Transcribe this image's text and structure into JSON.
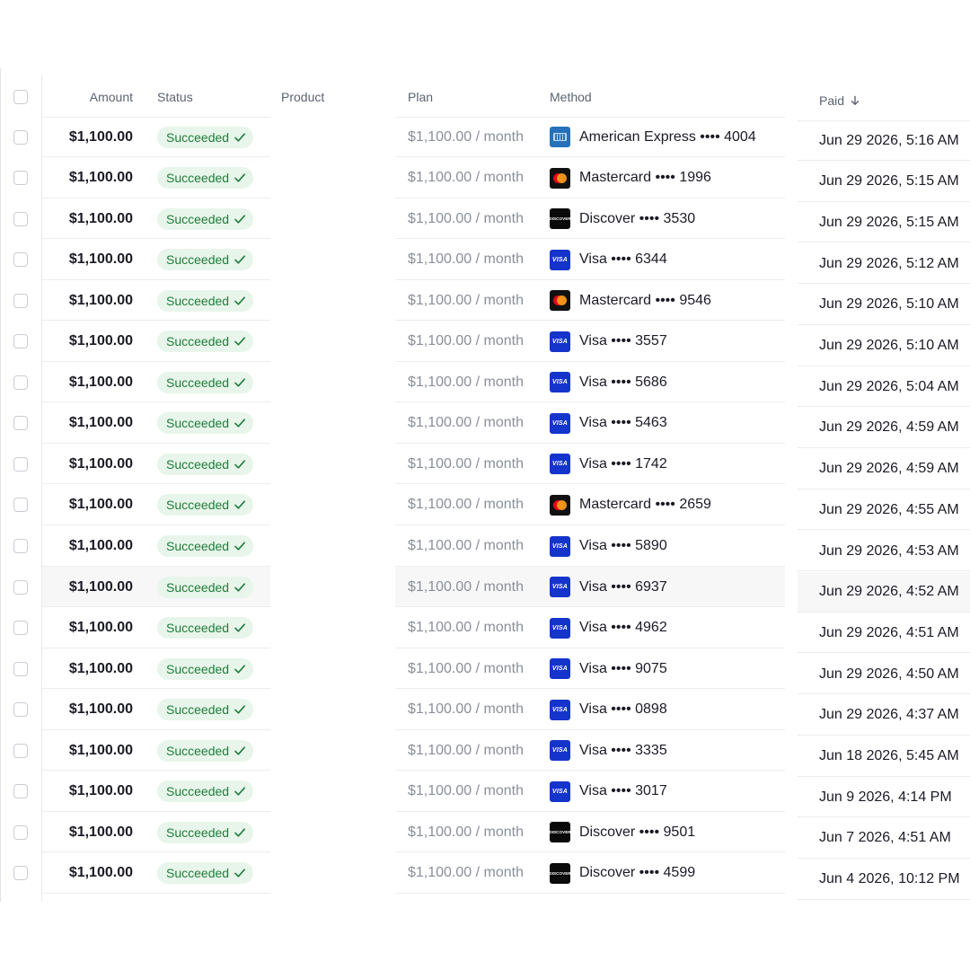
{
  "columns": {
    "amount": "Amount",
    "status": "Status",
    "product": "Product",
    "plan": "Plan",
    "method": "Method",
    "paid": "Paid"
  },
  "sort_indicator_icon": "arrow-down-icon",
  "rows": [
    {
      "amount": "$1,100.00",
      "status": "Succeeded",
      "product": "",
      "plan": "$1,100.00 / month",
      "card": "amex",
      "method": "American Express •••• 4004",
      "paid": "Jun 29 2026, 5:16 AM"
    },
    {
      "amount": "$1,100.00",
      "status": "Succeeded",
      "product": "",
      "plan": "$1,100.00 / month",
      "card": "mastercard",
      "method": "Mastercard •••• 1996",
      "paid": "Jun 29 2026, 5:15 AM"
    },
    {
      "amount": "$1,100.00",
      "status": "Succeeded",
      "product": "",
      "plan": "$1,100.00 / month",
      "card": "discover",
      "method": "Discover •••• 3530",
      "paid": "Jun 29 2026, 5:15 AM"
    },
    {
      "amount": "$1,100.00",
      "status": "Succeeded",
      "product": "",
      "plan": "$1,100.00 / month",
      "card": "visa",
      "method": "Visa •••• 6344",
      "paid": "Jun 29 2026, 5:12 AM"
    },
    {
      "amount": "$1,100.00",
      "status": "Succeeded",
      "product": "",
      "plan": "$1,100.00 / month",
      "card": "mastercard",
      "method": "Mastercard •••• 9546",
      "paid": "Jun 29 2026, 5:10 AM"
    },
    {
      "amount": "$1,100.00",
      "status": "Succeeded",
      "product": "",
      "plan": "$1,100.00 / month",
      "card": "visa",
      "method": "Visa •••• 3557",
      "paid": "Jun 29 2026, 5:10 AM"
    },
    {
      "amount": "$1,100.00",
      "status": "Succeeded",
      "product": "",
      "plan": "$1,100.00 / month",
      "card": "visa",
      "method": "Visa •••• 5686",
      "paid": "Jun 29 2026, 5:04 AM"
    },
    {
      "amount": "$1,100.00",
      "status": "Succeeded",
      "product": "",
      "plan": "$1,100.00 / month",
      "card": "visa",
      "method": "Visa •••• 5463",
      "paid": "Jun 29 2026, 4:59 AM"
    },
    {
      "amount": "$1,100.00",
      "status": "Succeeded",
      "product": "",
      "plan": "$1,100.00 / month",
      "card": "visa",
      "method": "Visa •••• 1742",
      "paid": "Jun 29 2026, 4:59 AM"
    },
    {
      "amount": "$1,100.00",
      "status": "Succeeded",
      "product": "",
      "plan": "$1,100.00 / month",
      "card": "mastercard",
      "method": "Mastercard •••• 2659",
      "paid": "Jun 29 2026, 4:55 AM"
    },
    {
      "amount": "$1,100.00",
      "status": "Succeeded",
      "product": "",
      "plan": "$1,100.00 / month",
      "card": "visa",
      "method": "Visa •••• 5890",
      "paid": "Jun 29 2026, 4:53 AM"
    },
    {
      "amount": "$1,100.00",
      "status": "Succeeded",
      "product": "",
      "plan": "$1,100.00 / month",
      "card": "visa",
      "method": "Visa •••• 6937",
      "paid": "Jun 29 2026, 4:52 AM",
      "hover": true
    },
    {
      "amount": "$1,100.00",
      "status": "Succeeded",
      "product": "",
      "plan": "$1,100.00 / month",
      "card": "visa",
      "method": "Visa •••• 4962",
      "paid": "Jun 29 2026, 4:51 AM"
    },
    {
      "amount": "$1,100.00",
      "status": "Succeeded",
      "product": "",
      "plan": "$1,100.00 / month",
      "card": "visa",
      "method": "Visa •••• 9075",
      "paid": "Jun 29 2026, 4:50 AM"
    },
    {
      "amount": "$1,100.00",
      "status": "Succeeded",
      "product": "",
      "plan": "$1,100.00 / month",
      "card": "visa",
      "method": "Visa •••• 0898",
      "paid": "Jun 29 2026, 4:37 AM"
    },
    {
      "amount": "$1,100.00",
      "status": "Succeeded",
      "product": "",
      "plan": "$1,100.00 / month",
      "card": "visa",
      "method": "Visa •••• 3335",
      "paid": "Jun 18 2026, 5:45 AM"
    },
    {
      "amount": "$1,100.00",
      "status": "Succeeded",
      "product": "",
      "plan": "$1,100.00 / month",
      "card": "visa",
      "method": "Visa •••• 3017",
      "paid": "Jun 9 2026, 4:14 PM"
    },
    {
      "amount": "$1,100.00",
      "status": "Succeeded",
      "product": "",
      "plan": "$1,100.00 / month",
      "card": "discover",
      "method": "Discover •••• 9501",
      "paid": "Jun 7 2026, 4:51 AM"
    },
    {
      "amount": "$1,100.00",
      "status": "Succeeded",
      "product": "",
      "plan": "$1,100.00 / month",
      "card": "discover",
      "method": "Discover •••• 4599",
      "paid": "Jun 4 2026, 10:12 PM"
    }
  ],
  "card_logo_text": {
    "visa": "VISA",
    "discover": "DISCOVER"
  },
  "colors": {
    "success_text": "#1e7d3b",
    "success_bg": "#e8f5ea",
    "visa": "#1434cb",
    "amex": "#2671b9"
  }
}
